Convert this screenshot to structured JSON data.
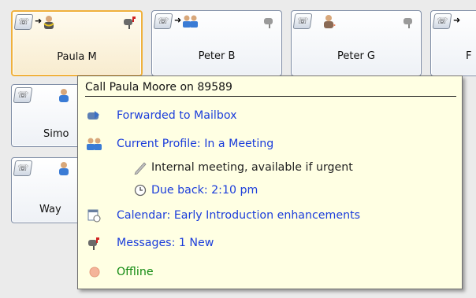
{
  "tiles": [
    {
      "name": "Paula M"
    },
    {
      "name": "Peter B"
    },
    {
      "name": "Peter G"
    },
    {
      "name": "F"
    },
    {
      "name": "Simo"
    },
    {
      "name": "Way"
    }
  ],
  "tooltip": {
    "title": "Call Paula Moore on 89589",
    "forward": "Forwarded to Mailbox",
    "profile": "Current Profile: In a Meeting",
    "note": "Internal meeting, available if urgent",
    "due_back": "Due back: 2:10 pm",
    "calendar": "Calendar: Early Introduction enhancements",
    "messages": "Messages: 1 New",
    "presence": "Offline"
  },
  "colors": {
    "link_blue": "#1b3ddb",
    "offline_green": "#118a11",
    "tooltip_bg": "#ffffe3",
    "selected_border": "#f0b13c"
  },
  "icons": [
    "phone-icon",
    "forward-arrow-icon",
    "person-icon",
    "mailbox-icon",
    "group-icon",
    "pencil-icon",
    "clock-icon",
    "calendar-icon",
    "presence-dot-icon"
  ]
}
